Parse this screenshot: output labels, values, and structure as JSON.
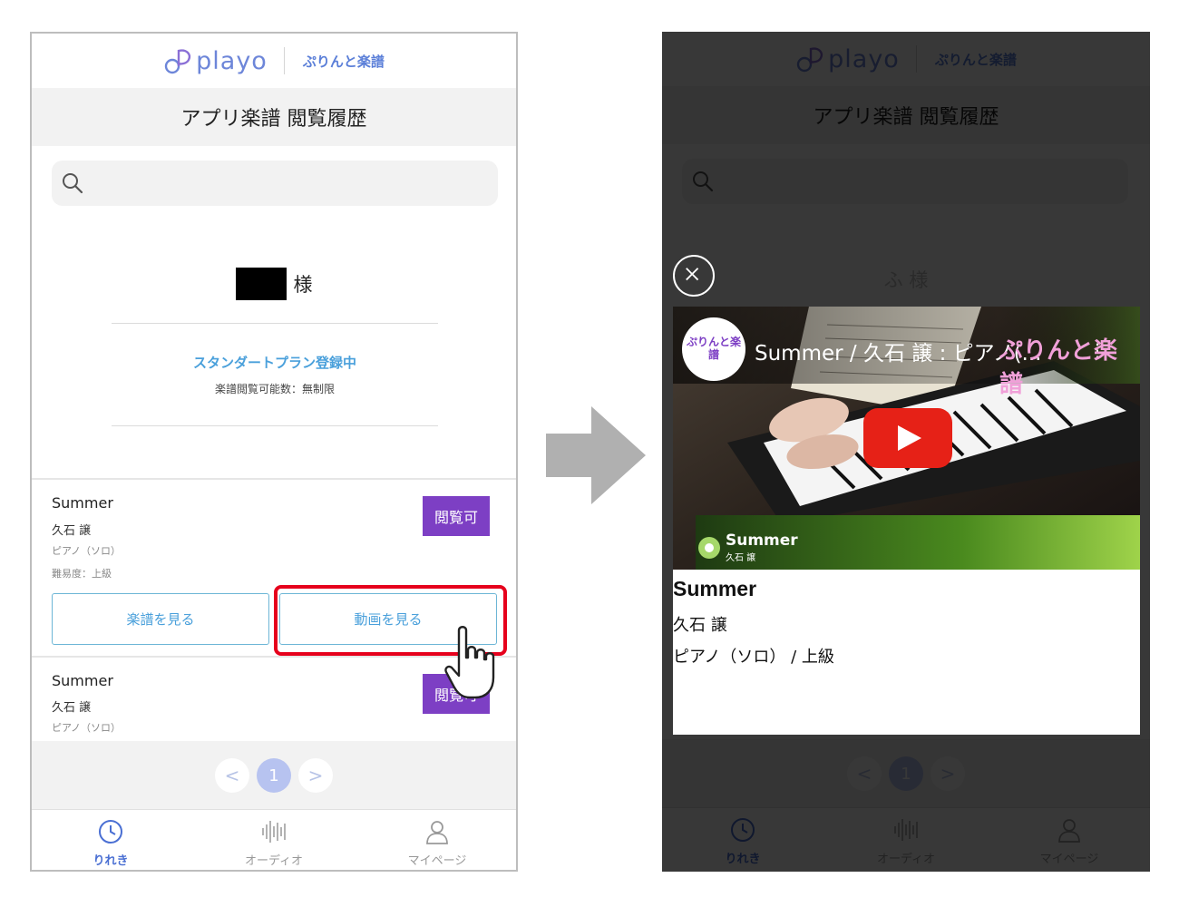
{
  "app": {
    "logo_text": "playo",
    "logo_sub": "ぷりんと楽譜",
    "page_title": "アプリ楽譜 閲覧履歴"
  },
  "user": {
    "suffix": "様",
    "suffix_right": "ふ 様"
  },
  "plan": {
    "name": "スタンダートプラン登録中",
    "count": "楽譜閲覧可能数：無制限"
  },
  "items": [
    {
      "title": "Summer",
      "artist": "久石 譲",
      "instrument": "ピアノ（ソロ）",
      "level": "難易度：上級",
      "badge": "閲覧可",
      "score_button": "楽譜を見る",
      "video_button": "動画を見る"
    },
    {
      "title": "Summer",
      "artist": "久石 譲",
      "instrument": "ピアノ（ソロ）",
      "badge": "閲覧可"
    }
  ],
  "pagination": {
    "prev": "<",
    "current": "1",
    "next": ">"
  },
  "tabs": [
    {
      "label": "りれき",
      "icon": "clock-icon",
      "active": true
    },
    {
      "label": "オーディオ",
      "icon": "audio-wave-icon",
      "active": false
    },
    {
      "label": "マイページ",
      "icon": "person-icon",
      "active": false
    }
  ],
  "modal": {
    "video_title": "Summer / 久石 譲 : ピアノ(...",
    "video_logo": "ぷりんと楽譜",
    "video_brand": "ぷりんと楽譜",
    "banner_title": "Summer",
    "banner_sub": "久石 譲",
    "title": "Summer",
    "artist": "久石 譲",
    "instrument_level": "ピアノ（ソロ） / 上級"
  },
  "colors": {
    "accent_purple": "#7d3fc4",
    "link_blue": "#4aa0db",
    "highlight_red": "#e6001c",
    "youtube_red": "#e62117"
  }
}
